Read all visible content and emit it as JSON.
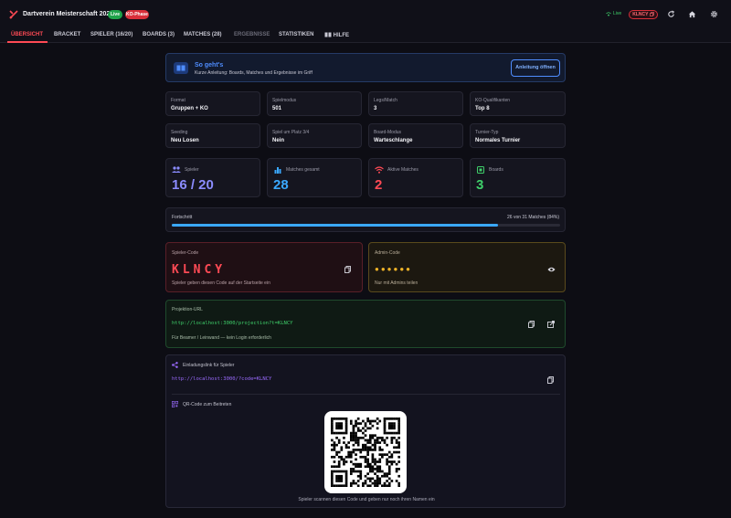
{
  "app": {
    "title": "Dartverein Meisterschaft 2026",
    "badge_live": "Live",
    "badge_phase": "KO-Phase",
    "live_status": "Live",
    "player_code_chip": "KLNCY"
  },
  "nav": {
    "tabs": [
      {
        "label": "ÜBERSICHT"
      },
      {
        "label": "BRACKET"
      },
      {
        "label": "SPIELER (16/20)"
      },
      {
        "label": "BOARDS (3)"
      },
      {
        "label": "MATCHES (28)"
      },
      {
        "label": "ERGEBNISSE"
      },
      {
        "label": "STATISTIKEN"
      },
      {
        "label": "HILFE"
      }
    ]
  },
  "guide": {
    "title": "So geht's",
    "subtitle": "Kurze Anleitung: Boards, Matches und Ergebnisse im Griff",
    "button": "Anleitung öffnen"
  },
  "settings": [
    {
      "label": "Format",
      "value": "Gruppen + KO"
    },
    {
      "label": "Spielmodus",
      "value": "501"
    },
    {
      "label": "Legs/Match",
      "value": "3"
    },
    {
      "label": "KO-Qualifikanten",
      "value": "Top 8"
    },
    {
      "label": "Seeding",
      "value": "Neu Losen"
    },
    {
      "label": "Spiel um Platz 3/4",
      "value": "Nein"
    },
    {
      "label": "Board-Modus",
      "value": "Warteschlange"
    },
    {
      "label": "Turnier-Typ",
      "value": "Normales Turnier"
    }
  ],
  "stats": [
    {
      "label": "Spieler",
      "value": "16 / 20",
      "color": "#8b8cff",
      "icon": "users-icon"
    },
    {
      "label": "Matches gesamt",
      "value": "28",
      "color": "#3aa8ff",
      "icon": "bar-chart-icon"
    },
    {
      "label": "Aktive Matches",
      "value": "2",
      "color": "#ff4a55",
      "icon": "wifi-icon"
    },
    {
      "label": "Boards",
      "value": "3",
      "color": "#3fcf6a",
      "icon": "board-icon"
    }
  ],
  "progress": {
    "label": "Fortschritt",
    "text": "26 von 31 Matches (84%)",
    "fraction": 0.84,
    "color": "#3aa8ff"
  },
  "player_code": {
    "label": "Spieler-Code",
    "code": "KLNCY",
    "hint": "Spieler geben diesen Code auf der Startseite ein"
  },
  "admin_code": {
    "label": "Admin-Code",
    "masked": "●●●●●●",
    "hint": "Nur mit Admins teilen"
  },
  "projection": {
    "label": "Projektion-URL",
    "url": "http://localhost:3000/projection?t=KLNCY",
    "hint": "Für Beamer / Leinwand — kein Login erforderlich"
  },
  "invite": {
    "label": "Einladungslink für Spieler",
    "url": "http://localhost:3000/?code=KLNCY",
    "qr_label": "QR-Code zum Beitreten",
    "qr_hint": "Spieler scannen diesen Code und geben nur noch ihren Namen ein"
  }
}
